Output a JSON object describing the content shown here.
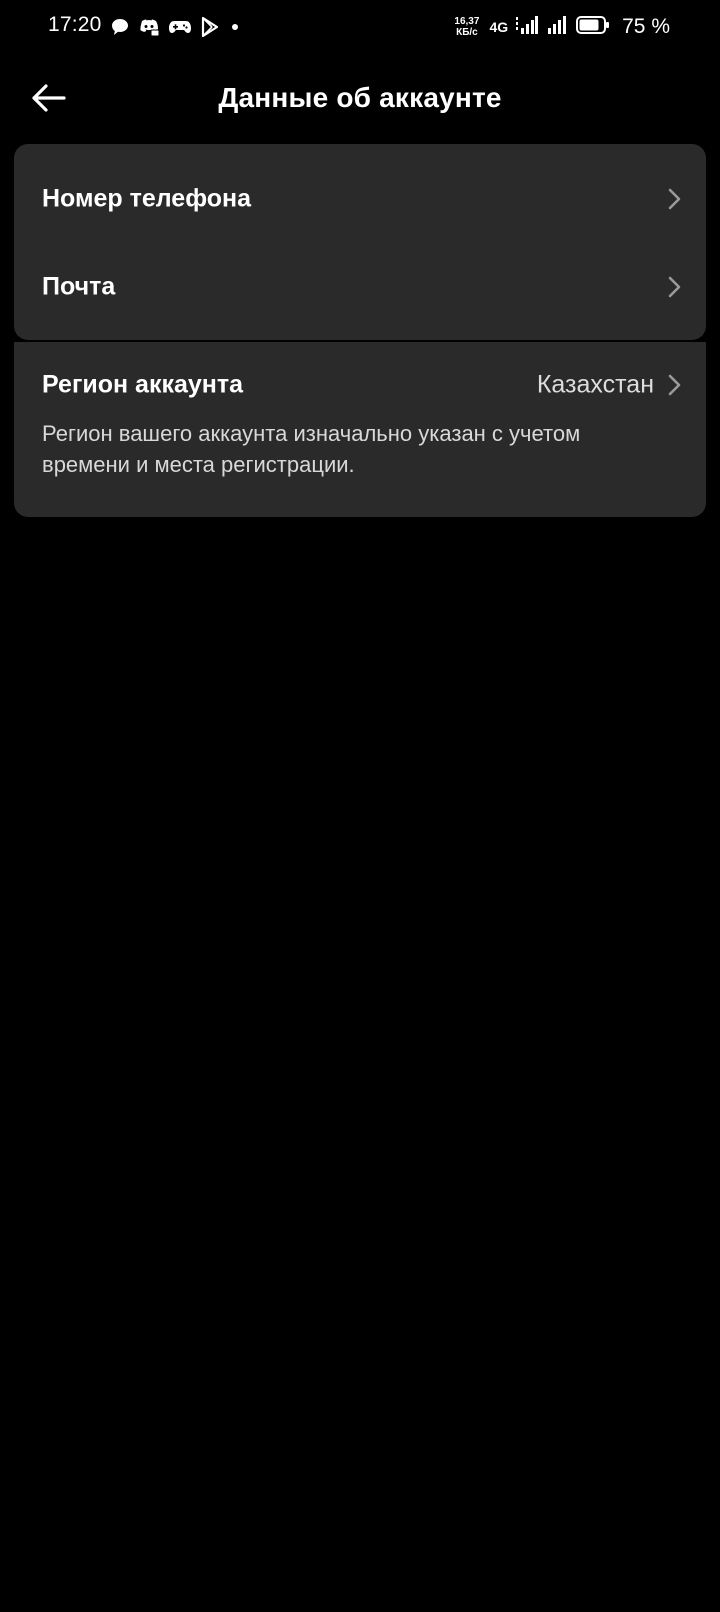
{
  "status_bar": {
    "time": "17:20",
    "speed_value": "16,37",
    "speed_unit": "КБ/с",
    "network": "4G",
    "battery_percent": "75 %",
    "icons": [
      "chat-bubble-icon",
      "discord-icon",
      "gamepad-icon",
      "play-store-icon",
      "dot-icon",
      "signal-icon",
      "signal-icon",
      "battery-icon"
    ]
  },
  "header": {
    "title": "Данные об аккаунте",
    "back_icon": "arrow-left-icon"
  },
  "account_card": {
    "items": [
      {
        "label": "Номер телефона",
        "icon": "chevron-right-icon"
      },
      {
        "label": "Почта",
        "icon": "chevron-right-icon"
      }
    ]
  },
  "region_card": {
    "label": "Регион аккаунта",
    "value": "Казахстан",
    "description": "Регион вашего аккаунта изначально указан с учетом времени и места регистрации.",
    "icon": "chevron-right-icon"
  },
  "colors": {
    "background": "#000000",
    "card": "#2a2a2a",
    "text": "#ffffff",
    "secondary_text": "#d8d8d8",
    "chevron": "#9a9a9a"
  }
}
